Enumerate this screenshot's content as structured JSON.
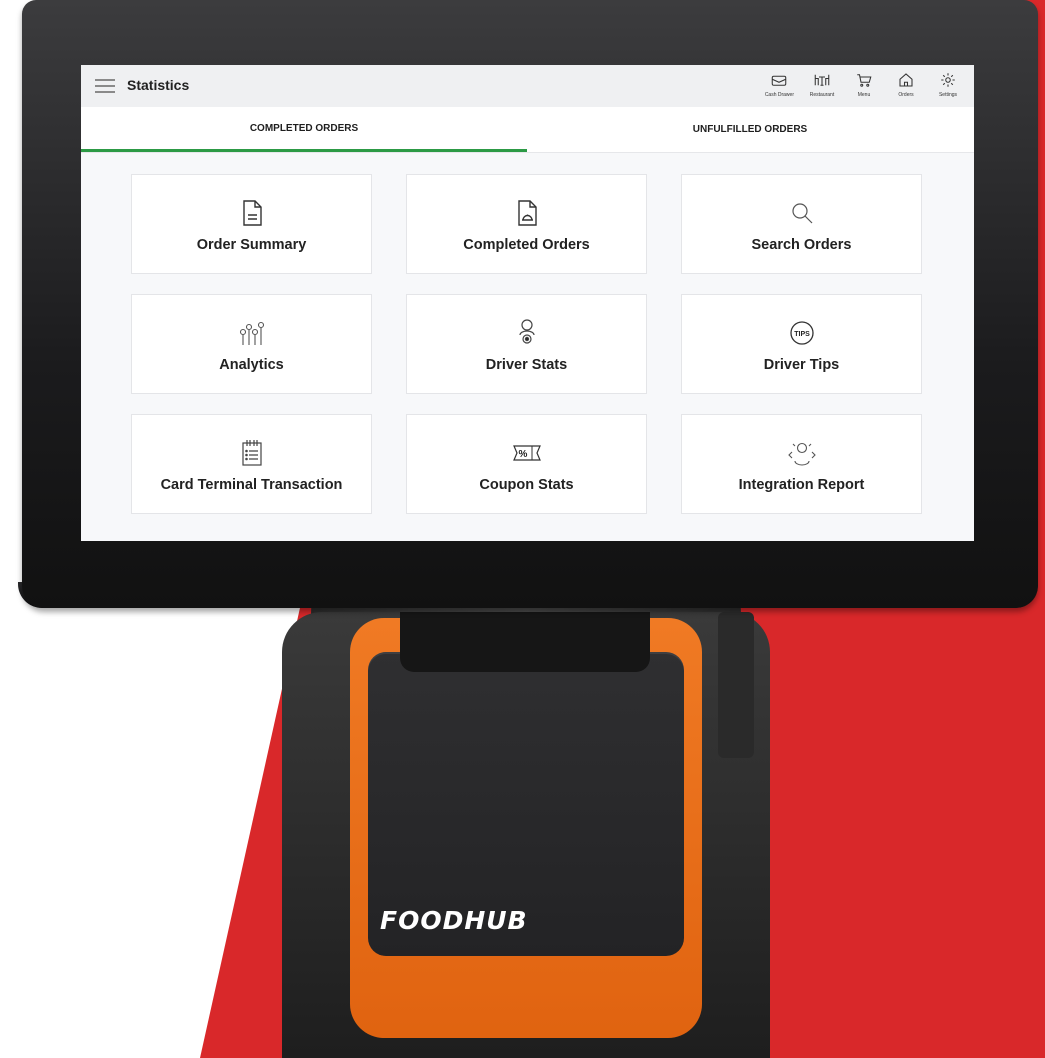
{
  "app": {
    "title": "Statistics"
  },
  "toolbar": [
    {
      "label": "Cash Drawer",
      "icon": "cash-drawer-icon"
    },
    {
      "label": "Restaurant",
      "icon": "restaurant-icon"
    },
    {
      "label": "Menu",
      "icon": "cart-icon"
    },
    {
      "label": "Orders",
      "icon": "home-icon"
    },
    {
      "label": "Settings",
      "icon": "gear-icon"
    }
  ],
  "tabs": [
    {
      "label": "COMPLETED ORDERS",
      "active": true
    },
    {
      "label": "UNFULFILLED ORDERS",
      "active": false
    }
  ],
  "cards": [
    {
      "label": "Order Summary",
      "icon": "document-icon"
    },
    {
      "label": "Completed Orders",
      "icon": "cloche-document-icon"
    },
    {
      "label": "Search Orders",
      "icon": "search-icon"
    },
    {
      "label": "Analytics",
      "icon": "analytics-icon"
    },
    {
      "label": "Driver Stats",
      "icon": "driver-icon"
    },
    {
      "label": "Driver Tips",
      "icon": "tips-icon"
    },
    {
      "label": "Card Terminal Transaction",
      "icon": "receipt-icon"
    },
    {
      "label": "Coupon Stats",
      "icon": "coupon-icon"
    },
    {
      "label": "Integration Report",
      "icon": "integration-icon"
    }
  ],
  "brand": {
    "logo_text": "FOODHUB"
  },
  "colors": {
    "accent": "#2c9a45",
    "backdrop": "#d9282a",
    "printer": "#f07a24"
  }
}
